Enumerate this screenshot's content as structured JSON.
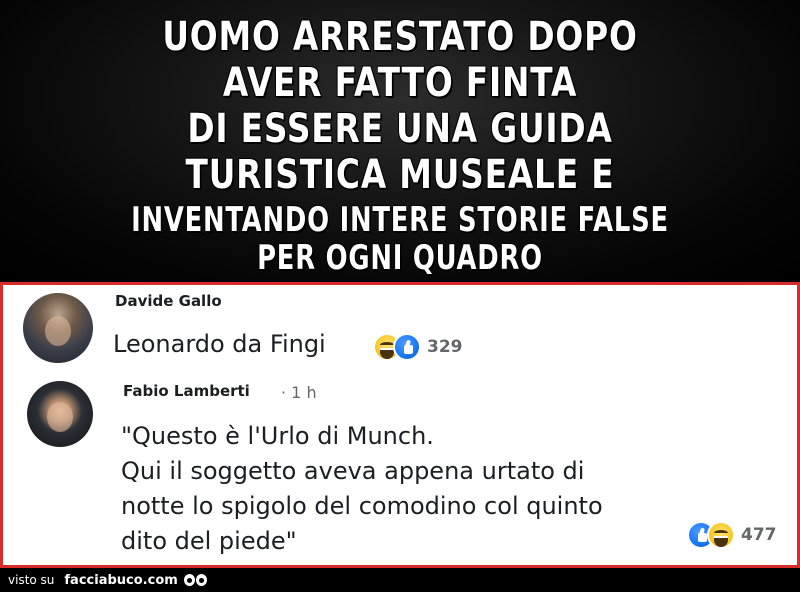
{
  "headline": {
    "lines": [
      "UOMO ARRESTATO DOPO",
      "AVER FATTO FINTA",
      "DI ESSERE UNA GUIDA",
      "TURISTICA MUSEALE E",
      "INVENTANDO INTERE STORIE FALSE",
      "PER OGNI QUADRO"
    ]
  },
  "comments": [
    {
      "author": "Davide Gallo",
      "meta": "",
      "text_lines": [
        "Leonardo da Fingi"
      ],
      "reactions": [
        "haha-icon",
        "like-icon"
      ],
      "reaction_count": "329"
    },
    {
      "author": "Fabio Lamberti",
      "meta": "· 1 h",
      "text_lines": [
        "\"Questo è l'Urlo di Munch.",
        "Qui il soggetto aveva appena urtato di",
        "notte lo spigolo del comodino col quinto",
        "dito del piede\""
      ],
      "reactions": [
        "like-icon",
        "haha-icon"
      ],
      "reaction_count": "477"
    }
  ],
  "footer": {
    "seen_on": "visto su",
    "brand": "facciabuco.com"
  },
  "colors": {
    "panel_border": "#d82b2b",
    "like_blue": "#1877f2",
    "haha_yellow": "#f7c21e",
    "meta_gray": "#65676b"
  }
}
